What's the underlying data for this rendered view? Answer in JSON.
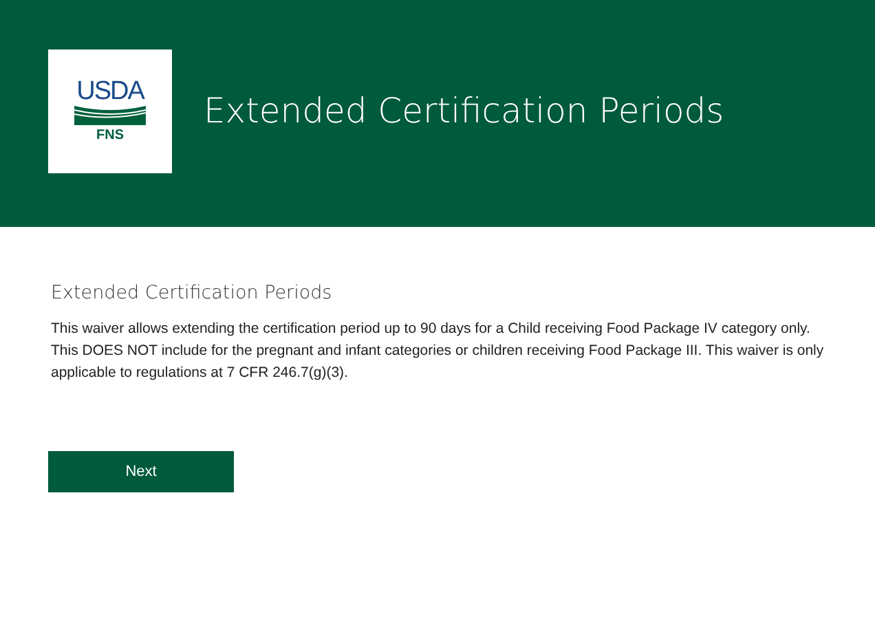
{
  "header": {
    "logo": {
      "agency": "USDA",
      "program": "FNS"
    },
    "title": "Extended Certification Periods"
  },
  "content": {
    "heading": "Extended Certification Periods",
    "body": "This waiver allows extending the certification period up to 90 days for a Child receiving Food Package IV category only. This DOES NOT include for the pregnant and infant categories or children receiving Food Package III. This waiver is only applicable to regulations at 7 CFR 246.7(g)(3)."
  },
  "buttons": [
    "Next"
  ]
}
